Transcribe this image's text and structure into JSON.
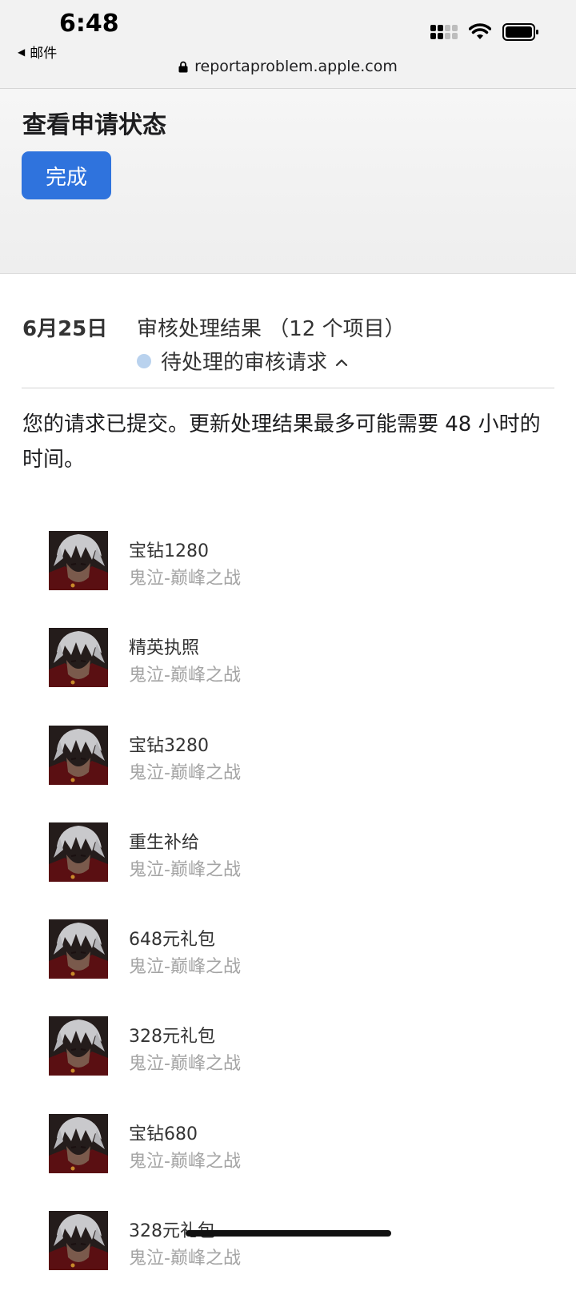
{
  "status_bar": {
    "time": "6:48",
    "back_label": "邮件",
    "url": "reportaproblem.apple.com",
    "icons": [
      "signal-icon",
      "wifi-icon",
      "battery-icon",
      "lock-icon"
    ]
  },
  "header": {
    "title": "查看申请状态",
    "done_label": "完成",
    "accent_color": "#2f73dd"
  },
  "request": {
    "date": "6月25日",
    "title": "审核处理结果 （12 个项目）",
    "status": "待处理的审核请求",
    "status_color": "#b9d2ee",
    "notice": "您的请求已提交。更新处理结果最多可能需要 48 小时的时间。"
  },
  "items": [
    {
      "name": "宝钻1280",
      "app": "鬼泣-巅峰之战"
    },
    {
      "name": "精英执照",
      "app": "鬼泣-巅峰之战"
    },
    {
      "name": "宝钻3280",
      "app": "鬼泣-巅峰之战"
    },
    {
      "name": "重生补给",
      "app": "鬼泣-巅峰之战"
    },
    {
      "name": "648元礼包",
      "app": "鬼泣-巅峰之战"
    },
    {
      "name": "328元礼包",
      "app": "鬼泣-巅峰之战"
    },
    {
      "name": "宝钻680",
      "app": "鬼泣-巅峰之战"
    },
    {
      "name": "328元礼包",
      "app": "鬼泣-巅峰之战"
    }
  ]
}
